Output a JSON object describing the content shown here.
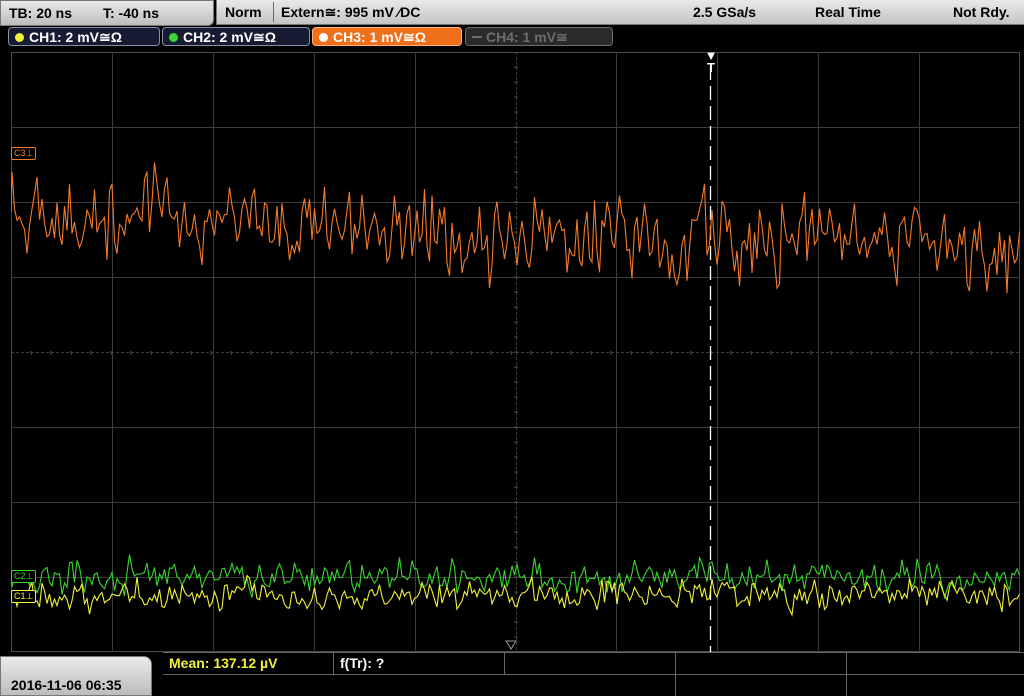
{
  "timebase": {
    "tb": "TB: 20 ns",
    "t_offset": "T: -40 ns"
  },
  "status": {
    "mode": "Norm",
    "trigger": "Extern≅: 995 mV ⁄DC",
    "sample_rate": "2.5 GSa/s",
    "acq_mode": "Real Time",
    "ready_state": "Not Rdy."
  },
  "channels": [
    {
      "label": "CH1: 2 mV≅Ω",
      "color": "#f2f23a",
      "active": false
    },
    {
      "label": "CH2: 2 mV≅Ω",
      "color": "#39d62d",
      "active": false
    },
    {
      "label": "CH3: 1 mV≅Ω",
      "color": "#ffffff",
      "active": true
    },
    {
      "label": "CH4: 1 mV≅",
      "color": "#6e6e6e",
      "active": false
    }
  ],
  "markers": {
    "ch3": "C3⊥",
    "ch2": "C2⊥",
    "ch1": "C1⊥",
    "trigger": "T"
  },
  "trace_colors": {
    "ch1": "#f2f23a",
    "ch2": "#39d62d",
    "ch3": "#f47a2a",
    "grid": "#3c3c3c"
  },
  "bottom": {
    "datetime": "2016-11-06 06:35",
    "mean_label": "Mean: 137.12 µV",
    "freq_label": "f(Tr): ?"
  }
}
